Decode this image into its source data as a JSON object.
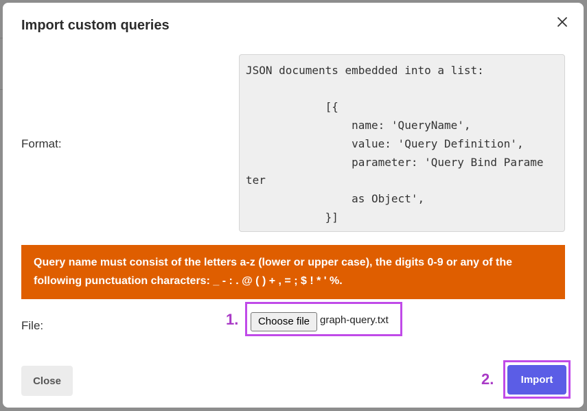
{
  "modal": {
    "title": "Import custom queries",
    "close_icon": "close-icon"
  },
  "format": {
    "label": "Format:",
    "example": "JSON documents embedded into a list:\n\n            [{\n                name: 'QueryName',\n                value: 'Query Definition',\n                parameter: 'Query Bind Parame\nter\n                as Object',\n            }]"
  },
  "warning": {
    "text": "Query name must consist of the letters a-z (lower or upper case), the digits 0-9 or any of the following punctuation characters: _ - : . @ ( ) + , = ; $ ! * ' %.",
    "color": "#df5e00"
  },
  "file": {
    "label": "File:",
    "choose_label": "Choose file",
    "selected_name": "graph-query.txt"
  },
  "annotations": {
    "step1": "1.",
    "step2": "2.",
    "highlight_color": "#c04ae8"
  },
  "footer": {
    "close_label": "Close",
    "import_label": "Import",
    "import_color": "#5b5de6"
  }
}
